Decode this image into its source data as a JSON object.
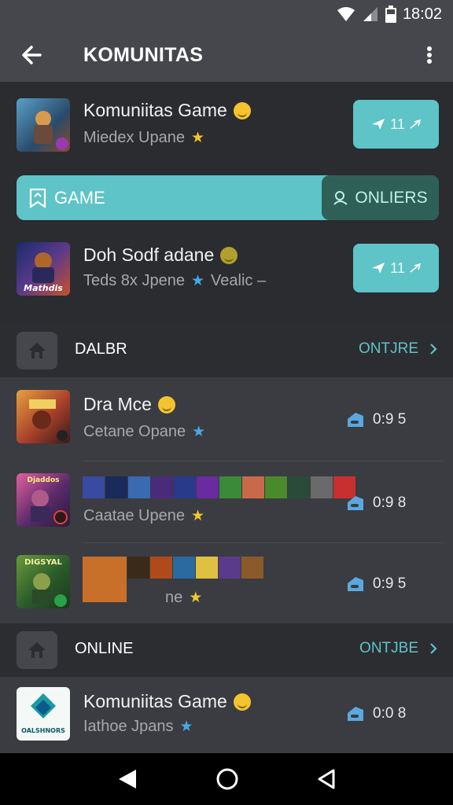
{
  "status": {
    "time": "18:02"
  },
  "app_bar": {
    "title": "KOMUNITAS"
  },
  "featured": [
    {
      "title": "Komuniitas Game",
      "subtitle": "Miedex Upane",
      "action": "11",
      "thumb_color": "#3a6a8e",
      "badge": "smile",
      "star": "gold"
    },
    {
      "title": "Doh Sodf adane",
      "subtitle": "Teds 8x Jpene",
      "subtitle_extra": "Vealic –",
      "action": "11",
      "thumb_color": "#2c3e86",
      "thumb_text": "Mathdis",
      "badge": "smile-olive",
      "star": "blue"
    }
  ],
  "segment": {
    "left_label": "GAME",
    "right_label": "ONLIERS"
  },
  "sections": [
    {
      "label": "DALBR",
      "link": "ONTJRE",
      "items": [
        {
          "title": "Dra Mce",
          "subtitle": "Cetane Opane",
          "count": "0:9 5",
          "thumb_color": "#a8502a",
          "star": "blue"
        },
        {
          "title": "",
          "subtitle": "Caatae Upene",
          "count": "0:9 8",
          "thumb_color": "#b04a8a",
          "thumb_text": "Djaddos",
          "star": "gold"
        },
        {
          "title": "",
          "subtitle": "ne",
          "count": "0:9 5",
          "thumb_color": "#3a6a2a",
          "thumb_text": "DIGSYAL",
          "star": "gold"
        }
      ]
    },
    {
      "label": "ONLINE",
      "link": "ONTJBE",
      "items": [
        {
          "title": "Komuniitas Game",
          "subtitle": "Iathoe Jpans",
          "count": "0:0 8",
          "thumb_color": "#f4f8f6",
          "thumb_text": "OALSHNORS",
          "star": "blue"
        }
      ]
    }
  ],
  "icons": {
    "back": "arrow-left-icon",
    "menu": "more-vert-icon",
    "send": "send-icon",
    "home": "home-icon",
    "chevron": "chevron-right-icon",
    "pin": "pin-icon",
    "ticket": "ticket-icon"
  },
  "colors": {
    "accent": "#5ec4c8",
    "accent_dark": "#2f6058",
    "background": "#2a2c30",
    "bar": "#45474c",
    "list": "#3a3c41"
  }
}
